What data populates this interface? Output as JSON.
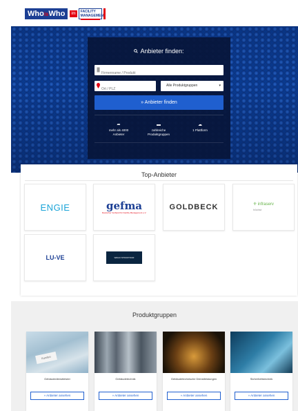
{
  "header": {
    "logo_word_1": "Who",
    "logo_word_inner": "is",
    "logo_word_2": "Who",
    "logo_im": "im",
    "logo_fm": "FACILITY MANAGEMENT"
  },
  "search": {
    "title": "Anbieter finden:",
    "company_placeholder": "Firmenname / Produkt",
    "location_placeholder": "Ort / PLZ",
    "group_select": "Alle Produktgruppen",
    "find_button": "» Anbieter finden",
    "stats": [
      {
        "icon": "arrow-icon",
        "line1": "mehr als 4000",
        "line2": "Anbieter"
      },
      {
        "icon": "truck-icon",
        "line1": "zahlreiche",
        "line2": "Produktgruppen"
      },
      {
        "icon": "cloud-icon",
        "line1": "1 Plattform",
        "line2": ""
      }
    ]
  },
  "top_providers": {
    "title": "Top-Anbieter",
    "logos": [
      {
        "name": "ENGIE",
        "text": "ENGIE"
      },
      {
        "name": "gefma",
        "text": "gefma",
        "sub": "Deutscher Verband für Facility Management e.V."
      },
      {
        "name": "GOLDBECK",
        "text": "GOLDBECK"
      },
      {
        "name": "infraserv",
        "text": "infraserv",
        "sub": "höchst"
      },
      {
        "name": "LU-VE",
        "text": "LU-VE"
      },
      {
        "name": "dark-brand",
        "text": "WAGO STRUKTOUR"
      }
    ]
  },
  "product_groups": {
    "title": "Produktgruppen",
    "items": [
      {
        "label": "Gebäudedienstleister",
        "button": "» Anbieter ansehen",
        "sticker": "Kunden"
      },
      {
        "label": "Gebäudetechnik",
        "button": "» Anbieter ansehen"
      },
      {
        "label": "Gebäudetechnische Dienstleistungen",
        "button": "» Anbieter ansehen"
      },
      {
        "label": "Sicherheitstechnik",
        "button": "» Anbieter ansehen"
      }
    ]
  },
  "colors": {
    "brand_blue": "#1c3f94",
    "brand_red": "#e30613",
    "button_blue": "#1f5fcf",
    "panel_dark": "#08163a"
  }
}
